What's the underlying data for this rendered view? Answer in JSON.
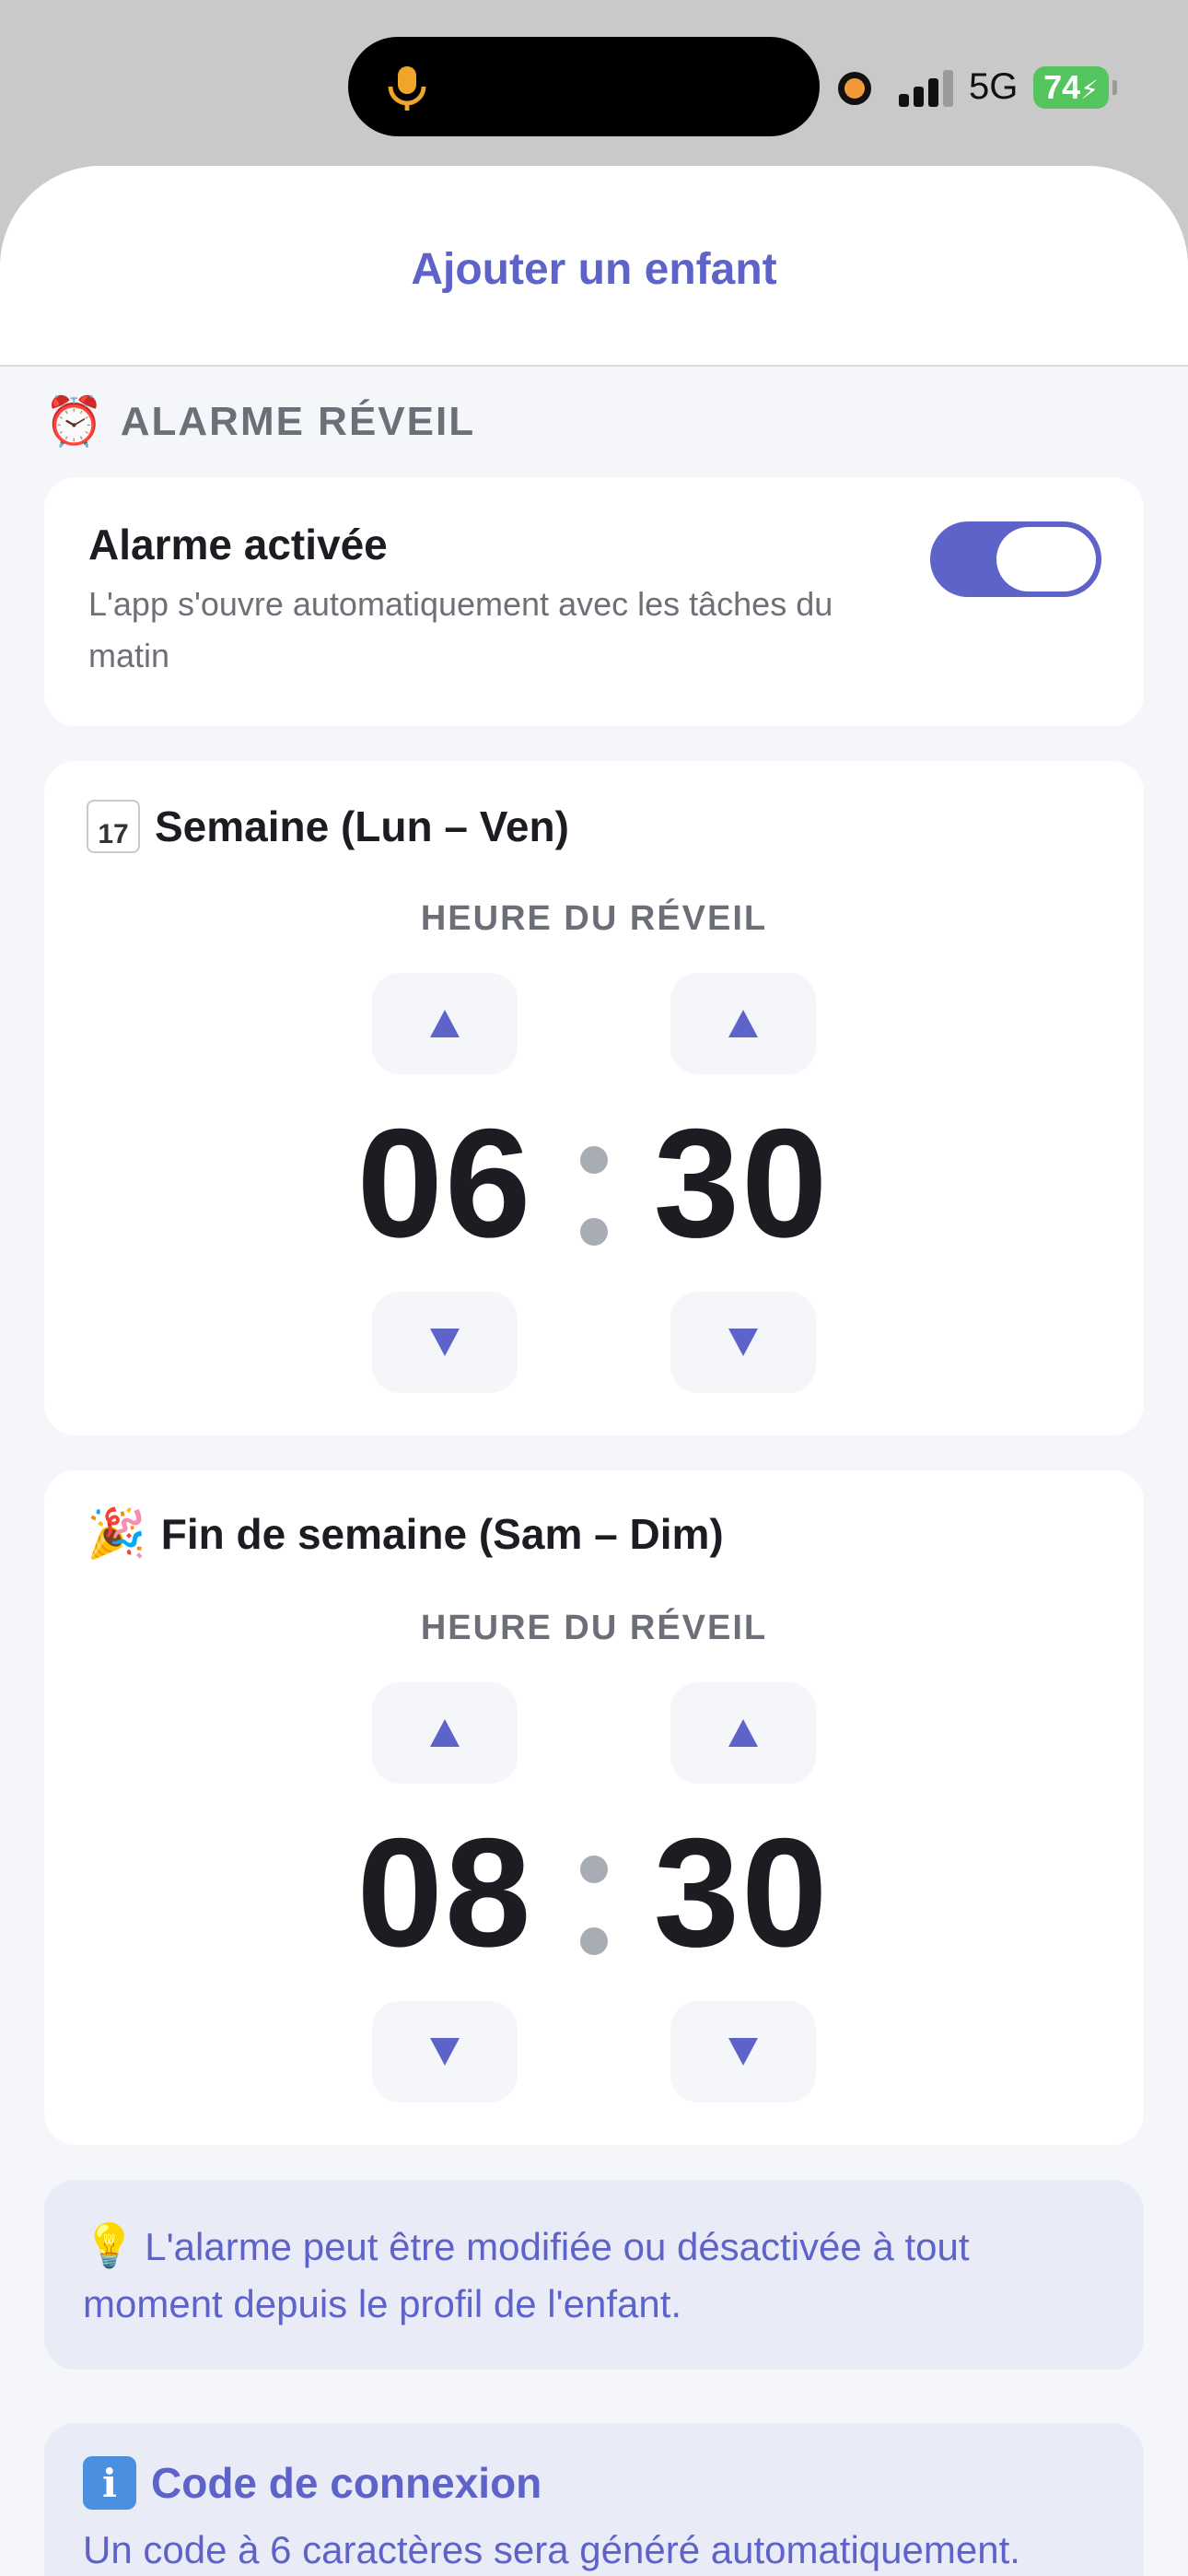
{
  "status_bar": {
    "network": "5G",
    "battery": "74",
    "mic_icon": "microphone-icon",
    "colors": {
      "recording_dot": "#f29a3a",
      "battery": "#54c45e"
    }
  },
  "sheet": {
    "title": "Ajouter un enfant"
  },
  "section": {
    "icon": "⏰",
    "label": "ALARME RÉVEIL"
  },
  "alarm_toggle": {
    "title": "Alarme activée",
    "description": "L'app s'ouvre automatiquement avec les tâches du matin",
    "enabled": true
  },
  "weekday": {
    "calendar_icon": "calendar-icon",
    "calendar_day": "17",
    "title": "Semaine (Lun – Ven)",
    "wake_label": "HEURE DU RÉVEIL",
    "hour": "06",
    "minute": "30"
  },
  "weekend": {
    "emoji": "🎉",
    "title": "Fin de semaine (Sam – Dim)",
    "wake_label": "HEURE DU RÉVEIL",
    "hour": "08",
    "minute": "30"
  },
  "tip": {
    "emoji": "💡",
    "text": "L'alarme peut être modifiée ou désactivée à tout moment depuis le profil de l'enfant."
  },
  "code": {
    "icon": "info-icon",
    "title": "Code de connexion",
    "description": "Un code à 6 caractères sera généré automatiquement."
  },
  "colors": {
    "accent": "#5d63c8",
    "text_dark": "#1c1d22",
    "text_muted": "#6c6f78",
    "background": "#f5f6fa",
    "info_bg": "#e9ebf7"
  }
}
